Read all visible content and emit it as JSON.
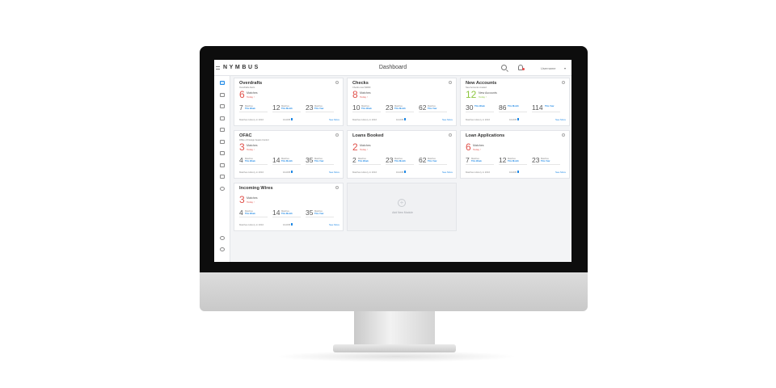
{
  "app": {
    "brand": "NYMBUS",
    "page_title": "Dashboard",
    "username": "Username",
    "user_caret": "▾"
  },
  "icons": [
    "monitor-icon",
    "user-icon",
    "card-icon",
    "chart-icon",
    "grid-icon",
    "calendar-icon",
    "briefcase-icon",
    "transfer-icon",
    "bar-chart-icon",
    "pie-chart-icon",
    "help-icon",
    "settings-icon"
  ],
  "colors": {
    "accent": "#1e88e5",
    "alert": "#e0514b",
    "positive": "#8cc63e"
  },
  "cards": [
    {
      "title": "Overdrafts",
      "subtitle": "Overdrafts Alerts",
      "count": "6",
      "count_label": "Matches",
      "today": "Today ↑",
      "stats": [
        {
          "num": "7",
          "label": "Matches",
          "period": "This Week"
        },
        {
          "num": "12",
          "label": "Matches",
          "period": "This Month"
        },
        {
          "num": "23",
          "label": "Matches",
          "period": "This Year"
        }
      ],
      "history": "Matches History in 2016",
      "counter": "10x005",
      "see_more": "See More"
    },
    {
      "title": "Checks",
      "subtitle": "Checks over $3000",
      "count": "8",
      "count_label": "Matches",
      "today": "Today ↑",
      "stats": [
        {
          "num": "10",
          "label": "Matches",
          "period": "This Week"
        },
        {
          "num": "23",
          "label": "Matches",
          "period": "This Month"
        },
        {
          "num": "62",
          "label": "Matches",
          "period": "This Year"
        }
      ],
      "history": "Matches History in 2016",
      "counter": "10x005",
      "see_more": "See More"
    },
    {
      "title": "New Accounts",
      "subtitle": "New Accounts created",
      "count": "12",
      "count_label": "New Accounts",
      "today": "Today ↑",
      "stats": [
        {
          "num": "30",
          "label": "",
          "period": "This Week"
        },
        {
          "num": "86",
          "label": "",
          "period": "This Month"
        },
        {
          "num": "114",
          "label": "",
          "period": "This Year"
        }
      ],
      "history": "Matches History in 2016",
      "counter": "10x005",
      "see_more": "See More"
    },
    {
      "title": "OFAC",
      "subtitle": "Office of Foreign Assets Control",
      "count": "3",
      "count_label": "Matches",
      "today": "Today ↑",
      "stats": [
        {
          "num": "4",
          "label": "Matches",
          "period": "This Week"
        },
        {
          "num": "14",
          "label": "Matches",
          "period": "This Month"
        },
        {
          "num": "35",
          "label": "Matches",
          "period": "This Year"
        }
      ],
      "history": "Matches History in 2016",
      "counter": "10x005",
      "see_more": "See More"
    },
    {
      "title": "Loans Booked",
      "subtitle": "",
      "count": "2",
      "count_label": "Matches",
      "today": "Today ↑",
      "stats": [
        {
          "num": "2",
          "label": "Matches",
          "period": "This Week"
        },
        {
          "num": "23",
          "label": "Matches",
          "period": "This Month"
        },
        {
          "num": "62",
          "label": "Matches",
          "period": "This Year"
        }
      ],
      "history": "Matches History in 2016",
      "counter": "10x005",
      "see_more": "See More"
    },
    {
      "title": "Loan Applications",
      "subtitle": "",
      "count": "6",
      "count_label": "Matches",
      "today": "Today ↑",
      "stats": [
        {
          "num": "7",
          "label": "Matches",
          "period": "This Week"
        },
        {
          "num": "12",
          "label": "Matches",
          "period": "This Month"
        },
        {
          "num": "23",
          "label": "Matches",
          "period": "This Year"
        }
      ],
      "history": "Matches History in 2016",
      "counter": "10x005",
      "see_more": "See More"
    },
    {
      "title": "Incoming Wires",
      "subtitle": "",
      "count": "3",
      "count_label": "Matches",
      "today": "Today ↑",
      "stats": [
        {
          "num": "4",
          "label": "Matches",
          "period": "This Week"
        },
        {
          "num": "14",
          "label": "Matches",
          "period": "This Month"
        },
        {
          "num": "35",
          "label": "Matches",
          "period": "This Year"
        }
      ],
      "history": "Matches History in 2016",
      "counter": "10x005",
      "see_more": "See More"
    }
  ],
  "add_module": {
    "plus": "+",
    "label": "Add New Module"
  }
}
